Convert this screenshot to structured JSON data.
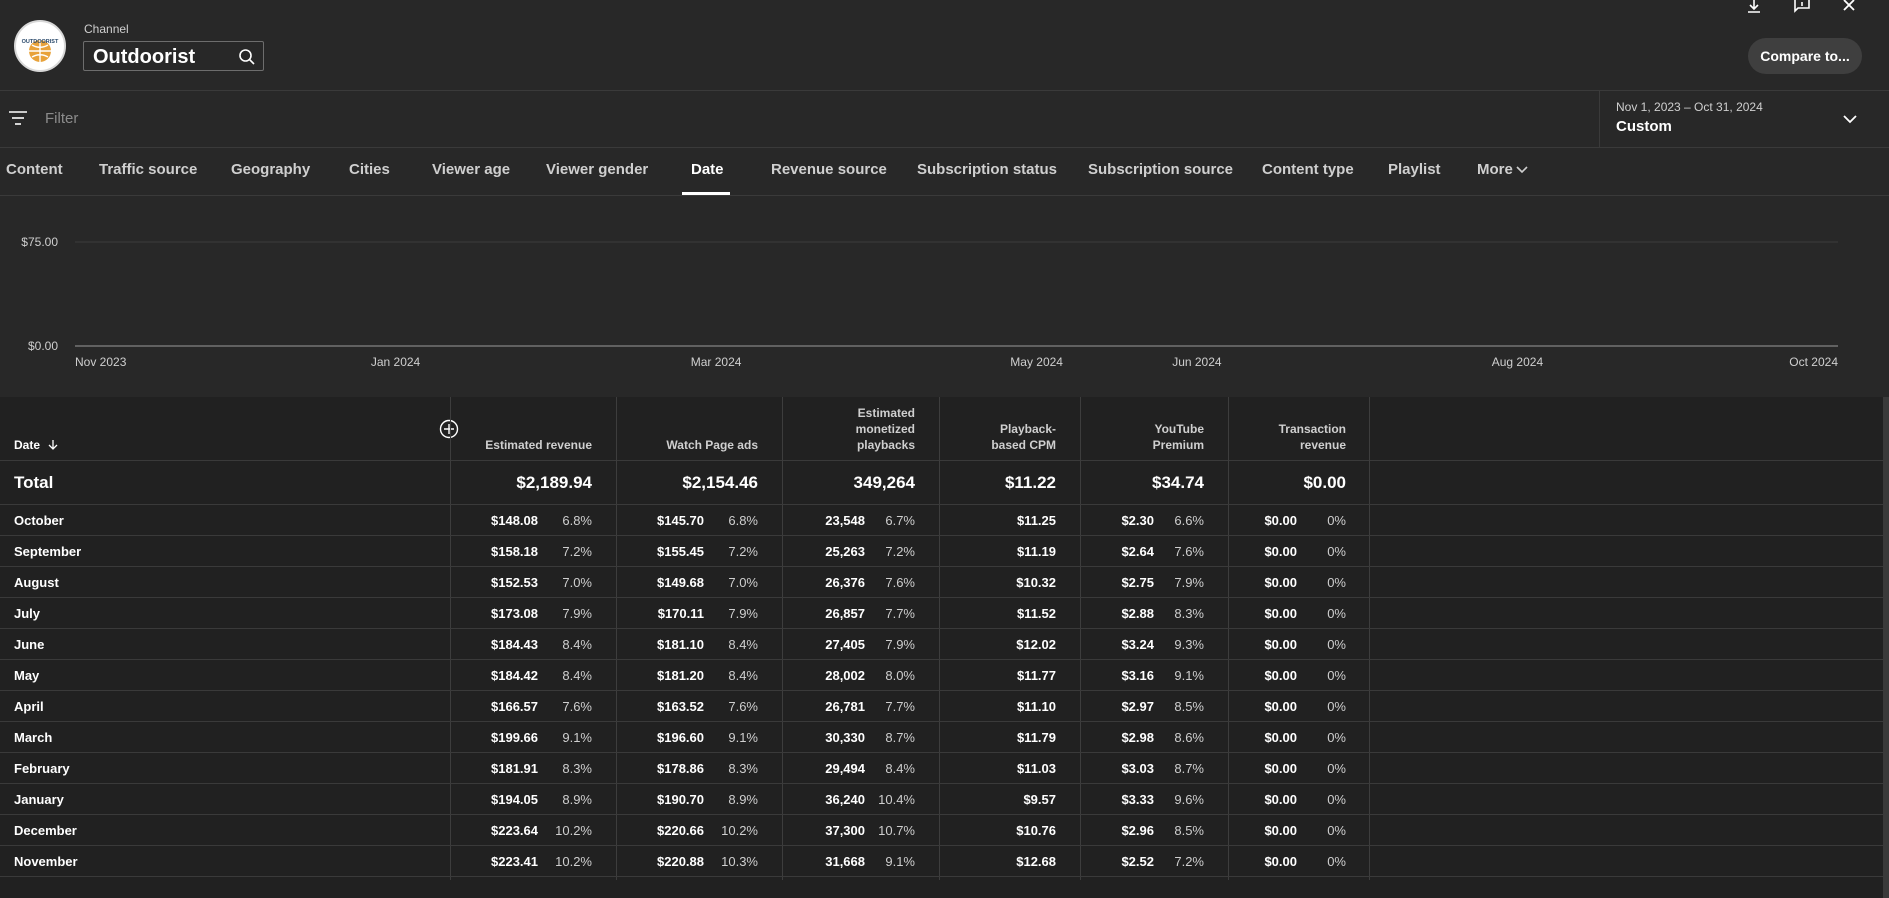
{
  "header": {
    "channel_caption": "Channel",
    "channel_name": "Outdoorist",
    "avatar_text": "OUTDOORIST",
    "compare_label": "Compare to..."
  },
  "filter": {
    "placeholder": "Filter"
  },
  "date_range": {
    "dates": "Nov 1, 2023 – Oct 31, 2024",
    "mode": "Custom"
  },
  "tabs": [
    {
      "label": "Content"
    },
    {
      "label": "Traffic source"
    },
    {
      "label": "Geography"
    },
    {
      "label": "Cities"
    },
    {
      "label": "Viewer age"
    },
    {
      "label": "Viewer gender"
    },
    {
      "label": "Date",
      "active": true
    },
    {
      "label": "Revenue source"
    },
    {
      "label": "Subscription status"
    },
    {
      "label": "Subscription source"
    },
    {
      "label": "Content type"
    },
    {
      "label": "Playlist"
    },
    {
      "label": "More"
    }
  ],
  "chart_data": {
    "type": "line",
    "x": [
      "Nov 2023",
      "Jan 2024",
      "Mar 2024",
      "May 2024",
      "Jun 2024",
      "Aug 2024",
      "Oct 2024"
    ],
    "y_ticks": [
      "$75.00",
      "$0.00"
    ],
    "ylim": [
      0,
      75
    ],
    "grid": true
  },
  "table": {
    "headers": {
      "date": "Date",
      "estimated_revenue": "Estimated revenue",
      "watch_page_ads": "Watch Page ads",
      "monetized_playbacks": "Estimated monetized playbacks",
      "cpm": "Playback-based CPM",
      "youtube_premium": "YouTube Premium",
      "transaction_revenue": "Transaction revenue"
    },
    "total": {
      "label": "Total",
      "estimated_revenue": "$2,189.94",
      "watch_page_ads": "$2,154.46",
      "monetized_playbacks": "349,264",
      "cpm": "$11.22",
      "youtube_premium": "$34.74",
      "transaction_revenue": "$0.00"
    },
    "rows": [
      {
        "month": "October",
        "rev": "$148.08",
        "rev_pct": "6.8%",
        "ads": "$145.70",
        "ads_pct": "6.8%",
        "plays": "23,548",
        "plays_pct": "6.7%",
        "cpm": "$11.25",
        "prem": "$2.30",
        "prem_pct": "6.6%",
        "trans": "$0.00",
        "trans_pct": "0%"
      },
      {
        "month": "September",
        "rev": "$158.18",
        "rev_pct": "7.2%",
        "ads": "$155.45",
        "ads_pct": "7.2%",
        "plays": "25,263",
        "plays_pct": "7.2%",
        "cpm": "$11.19",
        "prem": "$2.64",
        "prem_pct": "7.6%",
        "trans": "$0.00",
        "trans_pct": "0%"
      },
      {
        "month": "August",
        "rev": "$152.53",
        "rev_pct": "7.0%",
        "ads": "$149.68",
        "ads_pct": "7.0%",
        "plays": "26,376",
        "plays_pct": "7.6%",
        "cpm": "$10.32",
        "prem": "$2.75",
        "prem_pct": "7.9%",
        "trans": "$0.00",
        "trans_pct": "0%"
      },
      {
        "month": "July",
        "rev": "$173.08",
        "rev_pct": "7.9%",
        "ads": "$170.11",
        "ads_pct": "7.9%",
        "plays": "26,857",
        "plays_pct": "7.7%",
        "cpm": "$11.52",
        "prem": "$2.88",
        "prem_pct": "8.3%",
        "trans": "$0.00",
        "trans_pct": "0%"
      },
      {
        "month": "June",
        "rev": "$184.43",
        "rev_pct": "8.4%",
        "ads": "$181.10",
        "ads_pct": "8.4%",
        "plays": "27,405",
        "plays_pct": "7.9%",
        "cpm": "$12.02",
        "prem": "$3.24",
        "prem_pct": "9.3%",
        "trans": "$0.00",
        "trans_pct": "0%"
      },
      {
        "month": "May",
        "rev": "$184.42",
        "rev_pct": "8.4%",
        "ads": "$181.20",
        "ads_pct": "8.4%",
        "plays": "28,002",
        "plays_pct": "8.0%",
        "cpm": "$11.77",
        "prem": "$3.16",
        "prem_pct": "9.1%",
        "trans": "$0.00",
        "trans_pct": "0%"
      },
      {
        "month": "April",
        "rev": "$166.57",
        "rev_pct": "7.6%",
        "ads": "$163.52",
        "ads_pct": "7.6%",
        "plays": "26,781",
        "plays_pct": "7.7%",
        "cpm": "$11.10",
        "prem": "$2.97",
        "prem_pct": "8.5%",
        "trans": "$0.00",
        "trans_pct": "0%"
      },
      {
        "month": "March",
        "rev": "$199.66",
        "rev_pct": "9.1%",
        "ads": "$196.60",
        "ads_pct": "9.1%",
        "plays": "30,330",
        "plays_pct": "8.7%",
        "cpm": "$11.79",
        "prem": "$2.98",
        "prem_pct": "8.6%",
        "trans": "$0.00",
        "trans_pct": "0%"
      },
      {
        "month": "February",
        "rev": "$181.91",
        "rev_pct": "8.3%",
        "ads": "$178.86",
        "ads_pct": "8.3%",
        "plays": "29,494",
        "plays_pct": "8.4%",
        "cpm": "$11.03",
        "prem": "$3.03",
        "prem_pct": "8.7%",
        "trans": "$0.00",
        "trans_pct": "0%"
      },
      {
        "month": "January",
        "rev": "$194.05",
        "rev_pct": "8.9%",
        "ads": "$190.70",
        "ads_pct": "8.9%",
        "plays": "36,240",
        "plays_pct": "10.4%",
        "cpm": "$9.57",
        "prem": "$3.33",
        "prem_pct": "9.6%",
        "trans": "$0.00",
        "trans_pct": "0%"
      },
      {
        "month": "December",
        "rev": "$223.64",
        "rev_pct": "10.2%",
        "ads": "$220.66",
        "ads_pct": "10.2%",
        "plays": "37,300",
        "plays_pct": "10.7%",
        "cpm": "$10.76",
        "prem": "$2.96",
        "prem_pct": "8.5%",
        "trans": "$0.00",
        "trans_pct": "0%"
      },
      {
        "month": "November",
        "rev": "$223.41",
        "rev_pct": "10.2%",
        "ads": "$220.88",
        "ads_pct": "10.3%",
        "plays": "31,668",
        "plays_pct": "9.1%",
        "cpm": "$12.68",
        "prem": "$2.52",
        "prem_pct": "7.2%",
        "trans": "$0.00",
        "trans_pct": "0%"
      }
    ]
  },
  "icons": {
    "download": "download-icon",
    "feedback": "feedback-icon",
    "close": "close-icon",
    "search": "search-icon",
    "filter": "filter-icon",
    "chevron": "chevron-down-icon",
    "add_column": "add-column-icon",
    "sort": "sort-arrow-icon"
  }
}
